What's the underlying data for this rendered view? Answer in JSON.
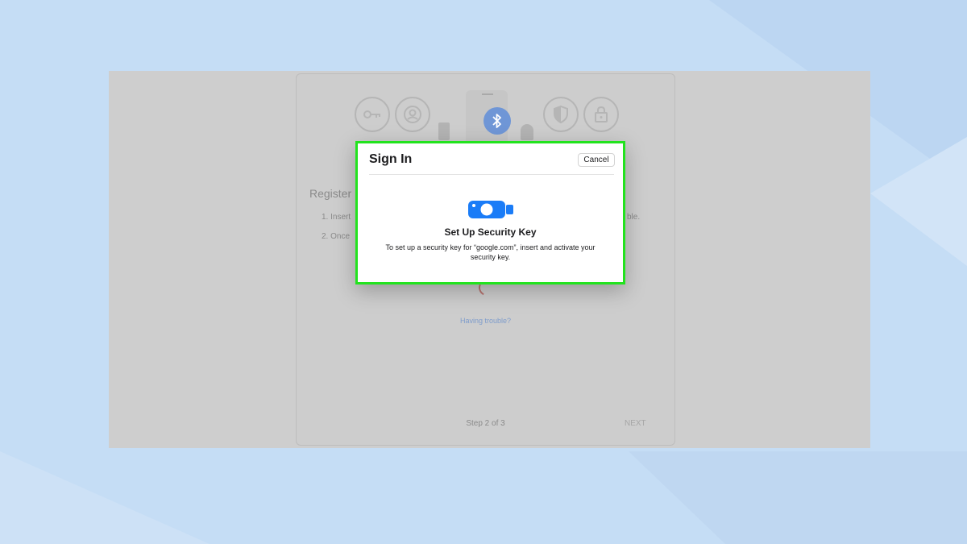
{
  "background": {
    "color": "#c5ddf5"
  },
  "page": {
    "register_title": "Register",
    "step1_prefix": "1.  Insert",
    "step2_prefix": "2.  Once",
    "step1_suffix": "ble.",
    "trouble_link": "Having trouble?",
    "step_count": "Step 2 of 3",
    "next_label": "NEXT",
    "icons": [
      "key-icon",
      "account-icon",
      "bluetooth-icon",
      "shield-icon",
      "lock-icon"
    ]
  },
  "dialog": {
    "title": "Sign In",
    "cancel_label": "Cancel",
    "heading": "Set Up Security Key",
    "body": "To set up a security key for “google.com”, insert and activate your security key.",
    "key_color": "#1a7cf7",
    "highlight_color": "#22e31e"
  }
}
